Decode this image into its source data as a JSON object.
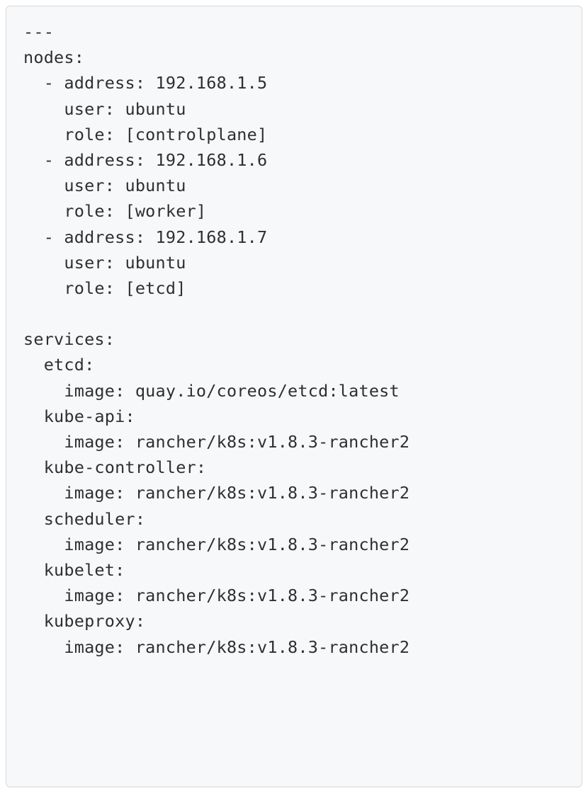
{
  "code": {
    "header": "---",
    "nodes_key": "nodes:",
    "nodes": [
      {
        "address_line": "  - address: 192.168.1.5",
        "user_line": "    user: ubuntu",
        "role_line": "    role: [controlplane]"
      },
      {
        "address_line": "  - address: 192.168.1.6",
        "user_line": "    user: ubuntu",
        "role_line": "    role: [worker]"
      },
      {
        "address_line": "  - address: 192.168.1.7",
        "user_line": "    user: ubuntu",
        "role_line": "    role: [etcd]"
      }
    ],
    "blank": "",
    "services_key": "services:",
    "services": {
      "etcd_key": "  etcd:",
      "etcd_image": "    image: quay.io/coreos/etcd:latest",
      "kubeapi_key": "  kube-api:",
      "kubeapi_image": "    image: rancher/k8s:v1.8.3-rancher2",
      "kubecontroller_key": "  kube-controller:",
      "kubecontroller_image": "    image: rancher/k8s:v1.8.3-rancher2",
      "scheduler_key": "  scheduler:",
      "scheduler_image": "    image: rancher/k8s:v1.8.3-rancher2",
      "kubelet_key": "  kubelet:",
      "kubelet_image": "    image: rancher/k8s:v1.8.3-rancher2",
      "kubeproxy_key": "  kubeproxy:",
      "kubeproxy_image": "    image: rancher/k8s:v1.8.3-rancher2"
    }
  }
}
